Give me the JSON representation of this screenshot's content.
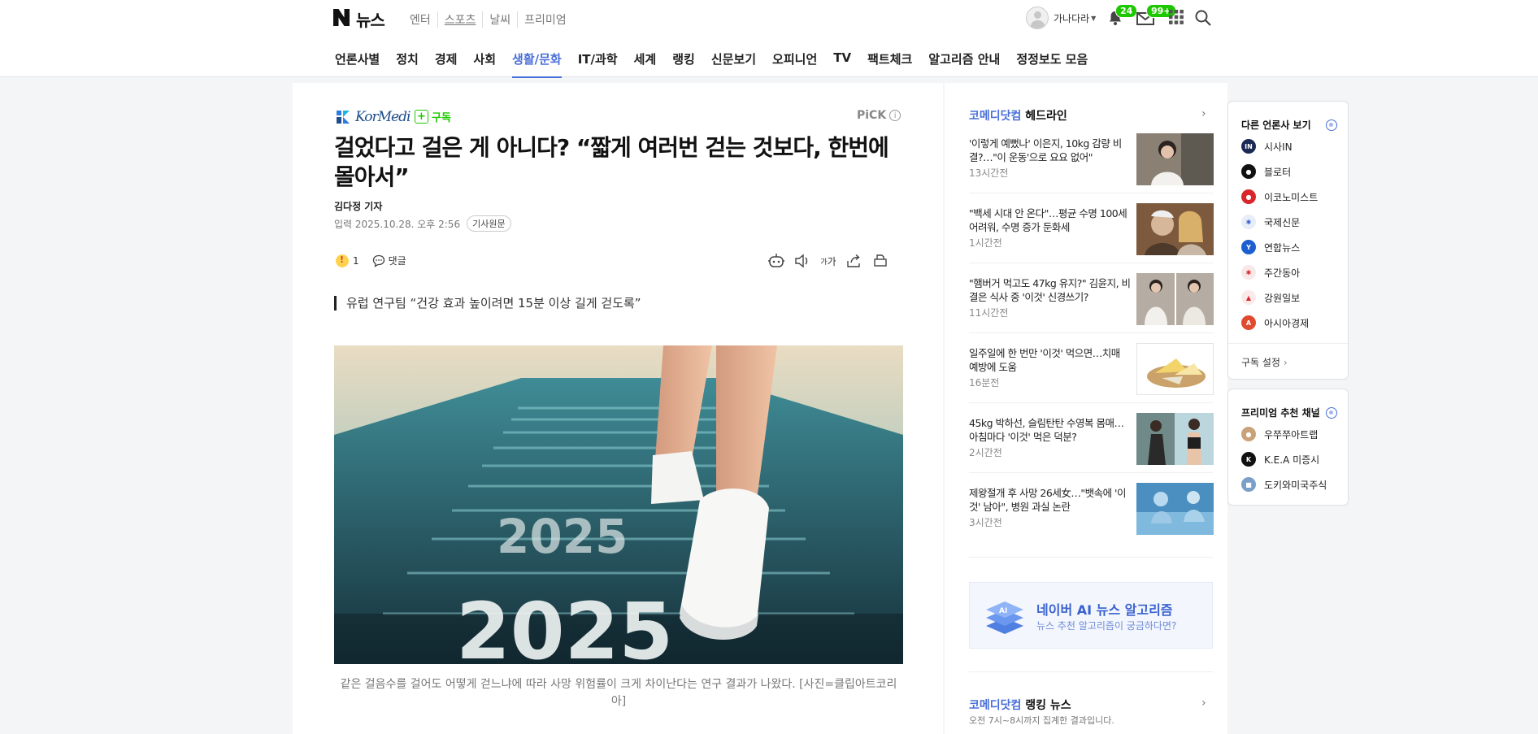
{
  "header": {
    "logo_text": "뉴스",
    "service_links": [
      "엔터",
      "스포츠",
      "날씨",
      "프리미엄"
    ],
    "username": "가나다라",
    "notification_count": "24",
    "mail_count": "99+",
    "nav": [
      "언론사별",
      "정치",
      "경제",
      "사회",
      "생활/문화",
      "IT/과학",
      "세계",
      "랭킹",
      "신문보기",
      "오피니언",
      "TV",
      "팩트체크",
      "알고리즘 안내",
      "정정보도 모음"
    ],
    "active_nav": "생활/문화"
  },
  "article": {
    "press_name": "KorMedi",
    "subscribe_label": "구독",
    "pick_label": "PiCK",
    "title": "걸었다고 걸은 게 아니다? “짧게 여러번 걷는 것보다, 한번에 몰아서”",
    "reporter": "김다정 기자",
    "date_label": "입력 2025.10.28. 오후 2:56",
    "original_label": "기사원문",
    "reaction_count": "1",
    "comment_label": "댓글",
    "font_tool_label": "가",
    "subtitle": "유럽 연구팀 “건강 효과 높이려면 15분 이상 길게 걷도록”",
    "photo_text": "2025",
    "caption": "같은 걸음수를 걸어도 어떻게 걷느냐에 따라 사망 위험률이 크게 차이난다는 연구 결과가 나왔다. [사진=클립아트코리아]"
  },
  "headlines": {
    "brand": "코메디닷컴",
    "title_suffix": "헤드라인",
    "items": [
      {
        "text": "'이렇게 예뻤나' 이은지, 10kg 감량 비결?…\"이 운동'으로 요요 없어\"",
        "time": "13시간전"
      },
      {
        "text": "\"백세 시대 안 온다\"…평균 수명 100세 어려워, 수명 증가 둔화세",
        "time": "1시간전"
      },
      {
        "text": "\"햄버거 먹고도 47kg 유지?\" 김윤지, 비결은 식사 중 '이것' 신경쓰기?",
        "time": "11시간전"
      },
      {
        "text": "일주일에 한 번만 '이것' 먹으면…치매 예방에 도움",
        "time": "16분전"
      },
      {
        "text": "45kg 박하선, 슬림탄탄 수영복 몸매…아침마다 '이것' 먹은 덕분?",
        "time": "2시간전"
      },
      {
        "text": "제왕절개 후 사망 26세女…\"뱃속에 '이것' 남아\", 병원 과실 논란",
        "time": "3시간전"
      }
    ]
  },
  "ai_banner": {
    "title": "네이버 AI 뉴스 알고리즘",
    "subtitle": "뉴스 추천 알고리즘이 궁금하다면?",
    "icon_text": "AI"
  },
  "ranking": {
    "brand": "코메디닷컴",
    "title_suffix": "랭킹 뉴스",
    "subtitle": "오전 7시~8시까지 집계한 결과입니다."
  },
  "sidebar": {
    "other_press_title": "다른 언론사 보기",
    "other_press": [
      {
        "name": "시사IN",
        "logo": "IN",
        "color": "#1b2a55"
      },
      {
        "name": "블로터",
        "logo": "●",
        "color": "#111111"
      },
      {
        "name": "이코노미스트",
        "logo": "●",
        "color": "#d8262c"
      },
      {
        "name": "국제신문",
        "logo": "✱",
        "color": "#e8eef8"
      },
      {
        "name": "연합뉴스",
        "logo": "Y",
        "color": "#1d5fd1"
      },
      {
        "name": "주간동아",
        "logo": "✱",
        "color": "#f8e8e8"
      },
      {
        "name": "강원일보",
        "logo": "▲",
        "color": "#fbeaea"
      },
      {
        "name": "아시아경제",
        "logo": "A",
        "color": "#e04a2f"
      }
    ],
    "subscription_setting": "구독 설정",
    "premium_title": "프리미엄 추천 채널",
    "premium": [
      {
        "name": "우쭈쭈아트랩",
        "logo": "●",
        "color": "#caa27a"
      },
      {
        "name": "K.E.A 미증시",
        "logo": "K",
        "color": "#111111"
      },
      {
        "name": "도키와미국주식",
        "logo": "■",
        "color": "#7aa0c8"
      }
    ]
  }
}
